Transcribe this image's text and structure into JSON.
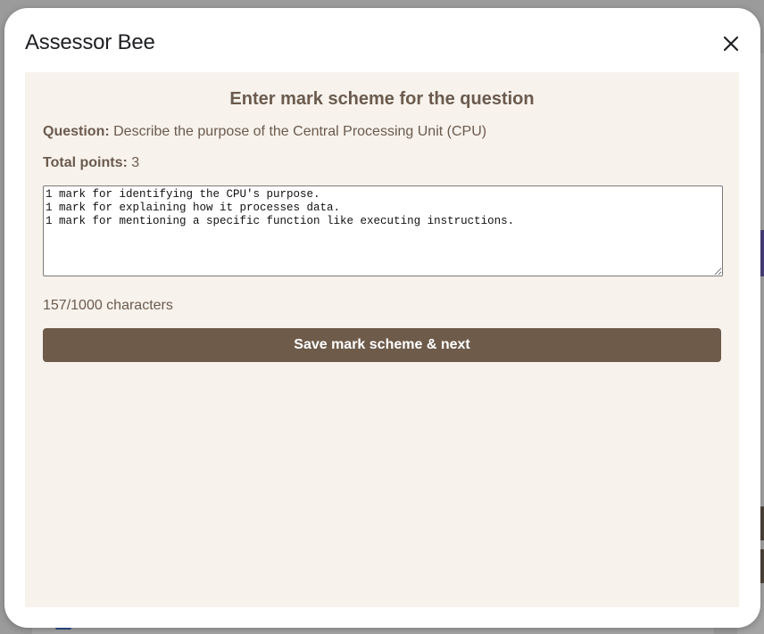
{
  "dialog": {
    "title": "Assessor Bee",
    "close_icon": "close-icon"
  },
  "panel": {
    "heading": "Enter mark scheme for the question",
    "question_label": "Question:",
    "question_text": "Describe the purpose of the Central Processing Unit (CPU)",
    "points_label": "Total points:",
    "points_value": "3",
    "mark_scheme_value": "1 mark for identifying the CPU's purpose.\n1 mark for explaining how it processes data.\n1 mark for mentioning a specific function like executing instructions.",
    "char_count": "157/1000 characters",
    "save_label": "Save mark scheme & next"
  },
  "colors": {
    "panel_bg": "#f7f2ec",
    "accent_brown": "#6e5b4a",
    "text_brown": "#6b5b4e"
  }
}
